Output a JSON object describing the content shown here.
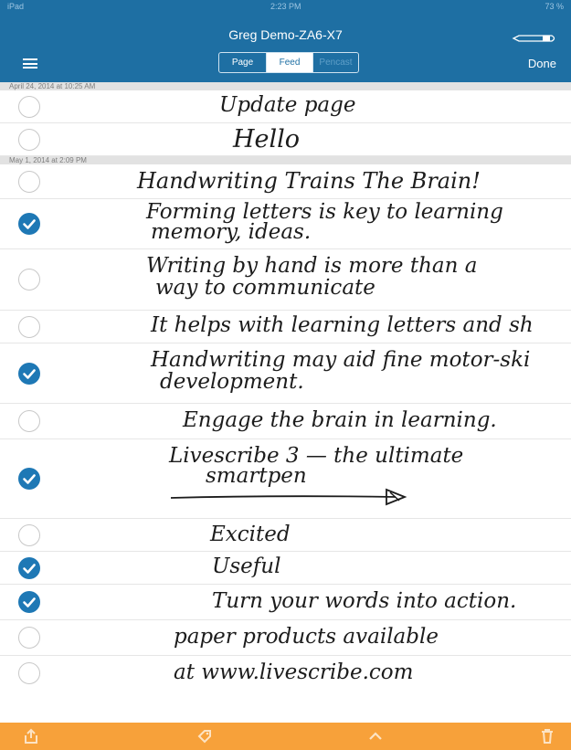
{
  "status": {
    "carrier": "iPad",
    "time": "2:23 PM",
    "battery": "73 %"
  },
  "nav": {
    "title": "Greg Demo-ZA6-X7",
    "done_label": "Done",
    "segments": [
      "Page",
      "Feed",
      "Pencast"
    ],
    "selected_segment": "Feed"
  },
  "sections": [
    {
      "header": "April 24, 2014 at 10:25 AM",
      "rows": [
        {
          "checked": false,
          "lines": [
            "Update page"
          ]
        },
        {
          "checked": false,
          "lines": [
            "Hello"
          ]
        }
      ]
    },
    {
      "header": "May 1, 2014 at 2:09 PM",
      "rows": [
        {
          "checked": false,
          "lines": [
            "Handwriting Trains The Brain!"
          ]
        },
        {
          "checked": true,
          "lines": [
            "Forming letters is key to learning",
            "memory, ideas."
          ]
        },
        {
          "checked": false,
          "lines": [
            "Writing by hand is more than a",
            "way to communicate"
          ]
        },
        {
          "checked": false,
          "lines": [
            "It helps with learning letters and sh"
          ]
        },
        {
          "checked": true,
          "lines": [
            "Handwriting may aid fine motor-ski",
            "development."
          ]
        },
        {
          "checked": false,
          "lines": [
            "Engage the brain in learning."
          ]
        },
        {
          "checked": true,
          "lines": [
            "Livescribe 3 — the ultimate",
            "smartpen"
          ]
        },
        {
          "checked": false,
          "lines": [
            "Excited"
          ]
        },
        {
          "checked": true,
          "lines": [
            "Useful"
          ]
        },
        {
          "checked": true,
          "lines": [
            "Turn your words into action."
          ]
        },
        {
          "checked": false,
          "lines": [
            "paper products available"
          ]
        },
        {
          "checked": false,
          "lines": [
            "at www.livescribe.com"
          ]
        }
      ]
    }
  ],
  "toolbar": {
    "icons": [
      "share-icon",
      "tag-icon",
      "chevron-up-icon",
      "trash-icon"
    ]
  },
  "colors": {
    "nav": "#1e6fa3",
    "check": "#1e78b5",
    "toolbar": "#f7a13a"
  }
}
